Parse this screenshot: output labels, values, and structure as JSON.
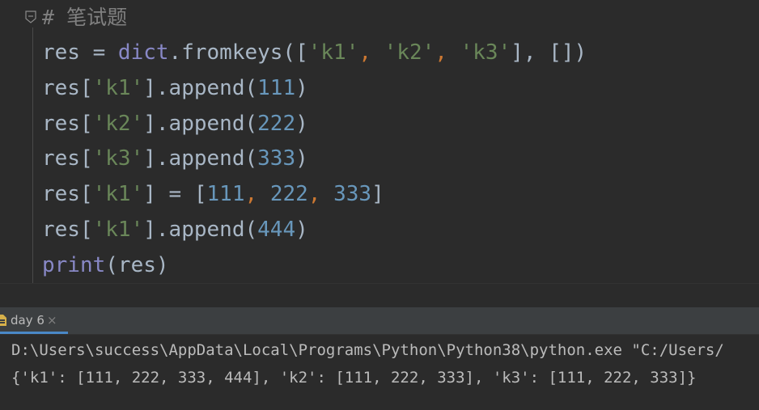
{
  "editor": {
    "comment": "# 笔试题",
    "lines": [
      [
        {
          "t": "res = ",
          "c": "plain"
        },
        {
          "t": "dict",
          "c": "kw"
        },
        {
          "t": ".fromkeys([",
          "c": "plain"
        },
        {
          "t": "'k1'",
          "c": "str"
        },
        {
          "t": ", ",
          "c": "comma"
        },
        {
          "t": "'k2'",
          "c": "str"
        },
        {
          "t": ", ",
          "c": "comma"
        },
        {
          "t": "'k3'",
          "c": "str"
        },
        {
          "t": "], ",
          "c": "plain"
        },
        {
          "t": "[])",
          "c": "plain"
        }
      ],
      [
        {
          "t": "res[",
          "c": "plain"
        },
        {
          "t": "'k1'",
          "c": "str"
        },
        {
          "t": "].append(",
          "c": "plain"
        },
        {
          "t": "111",
          "c": "num"
        },
        {
          "t": ")",
          "c": "plain"
        }
      ],
      [
        {
          "t": "res[",
          "c": "plain"
        },
        {
          "t": "'k2'",
          "c": "str"
        },
        {
          "t": "].append(",
          "c": "plain"
        },
        {
          "t": "222",
          "c": "num"
        },
        {
          "t": ")",
          "c": "plain"
        }
      ],
      [
        {
          "t": "res[",
          "c": "plain"
        },
        {
          "t": "'k3'",
          "c": "str"
        },
        {
          "t": "].append(",
          "c": "plain"
        },
        {
          "t": "333",
          "c": "num"
        },
        {
          "t": ")",
          "c": "plain"
        }
      ],
      [
        {
          "t": "res[",
          "c": "plain"
        },
        {
          "t": "'k1'",
          "c": "str"
        },
        {
          "t": "] = [",
          "c": "plain"
        },
        {
          "t": "111",
          "c": "num"
        },
        {
          "t": ", ",
          "c": "comma"
        },
        {
          "t": "222",
          "c": "num"
        },
        {
          "t": ", ",
          "c": "comma"
        },
        {
          "t": "333",
          "c": "num"
        },
        {
          "t": "]",
          "c": "plain"
        }
      ],
      [
        {
          "t": "res[",
          "c": "plain"
        },
        {
          "t": "'k1'",
          "c": "str"
        },
        {
          "t": "].append(",
          "c": "plain"
        },
        {
          "t": "444",
          "c": "num"
        },
        {
          "t": ")",
          "c": "plain"
        }
      ],
      [
        {
          "t": "print",
          "c": "kw"
        },
        {
          "t": "(res)",
          "c": "plain"
        }
      ]
    ]
  },
  "run_panel": {
    "tab_label": "day 6",
    "tab_close": "×",
    "tab_icon": "python-file-icon",
    "output": [
      "D:\\Users\\success\\AppData\\Local\\Programs\\Python\\Python38\\python.exe \"C:/Users/",
      "{'k1': [111, 222, 333, 444], 'k2': [111, 222, 333], 'k3': [111, 222, 333]}"
    ]
  },
  "colors": {
    "background": "#2b2b2b",
    "keyword": "#8888c6",
    "string": "#6a8759",
    "number": "#6897bb",
    "comma": "#cc7832",
    "text": "#a9b7c6",
    "comment": "#808080",
    "tab_accent": "#4a88c7"
  }
}
